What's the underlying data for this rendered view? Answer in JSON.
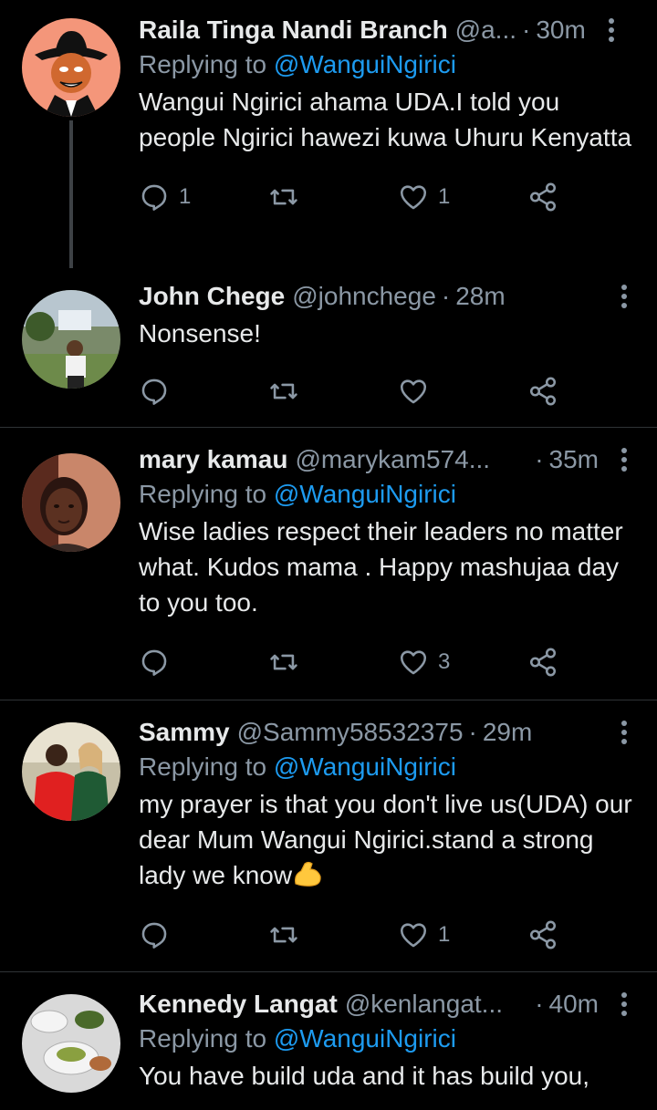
{
  "tweets": [
    {
      "name": "Raila Tinga Nandi Branch",
      "handle": "@a...",
      "time": "30m",
      "replying_label": "Replying to",
      "replying_to": "@WanguiNgirici",
      "text": "Wangui Ngirici ahama UDA.I told you people Ngirici hawezi kuwa Uhuru Kenyatta",
      "reply_count": "1",
      "retweet_count": "",
      "like_count": "1"
    },
    {
      "name": "John Chege",
      "handle": "@johnchege",
      "time": "28m",
      "text": "Nonsense!",
      "reply_count": "",
      "retweet_count": "",
      "like_count": ""
    },
    {
      "name": "mary kamau",
      "handle": "@marykam574...",
      "time": "35m",
      "replying_label": "Replying to",
      "replying_to": "@WanguiNgirici",
      "text": "Wise ladies respect their leaders no matter what. Kudos mama . Happy mashujaa day to you too.",
      "reply_count": "",
      "retweet_count": "",
      "like_count": "3"
    },
    {
      "name": "Sammy",
      "handle": "@Sammy58532375",
      "time": "29m",
      "replying_label": "Replying to",
      "replying_to": "@WanguiNgirici",
      "text": "my prayer is that you don't live us(UDA) our dear Mum Wangui Ngirici.stand a strong lady we know",
      "emoji": "flexed-biceps",
      "reply_count": "",
      "retweet_count": "",
      "like_count": "1"
    },
    {
      "name": "Kennedy Langat",
      "handle": "@kenlangat...",
      "time": "40m",
      "replying_label": "Replying to",
      "replying_to": "@WanguiNgirici",
      "text": "You have build uda and it has build you,"
    }
  ],
  "colors": {
    "background": "#000000",
    "primary_text": "#e7e9ea",
    "secondary_text": "#8b98a5",
    "mention": "#1d9bf0",
    "divider": "#2f3336"
  },
  "icons": [
    "more-vertical-icon",
    "reply-icon",
    "retweet-icon",
    "like-icon",
    "share-icon"
  ]
}
